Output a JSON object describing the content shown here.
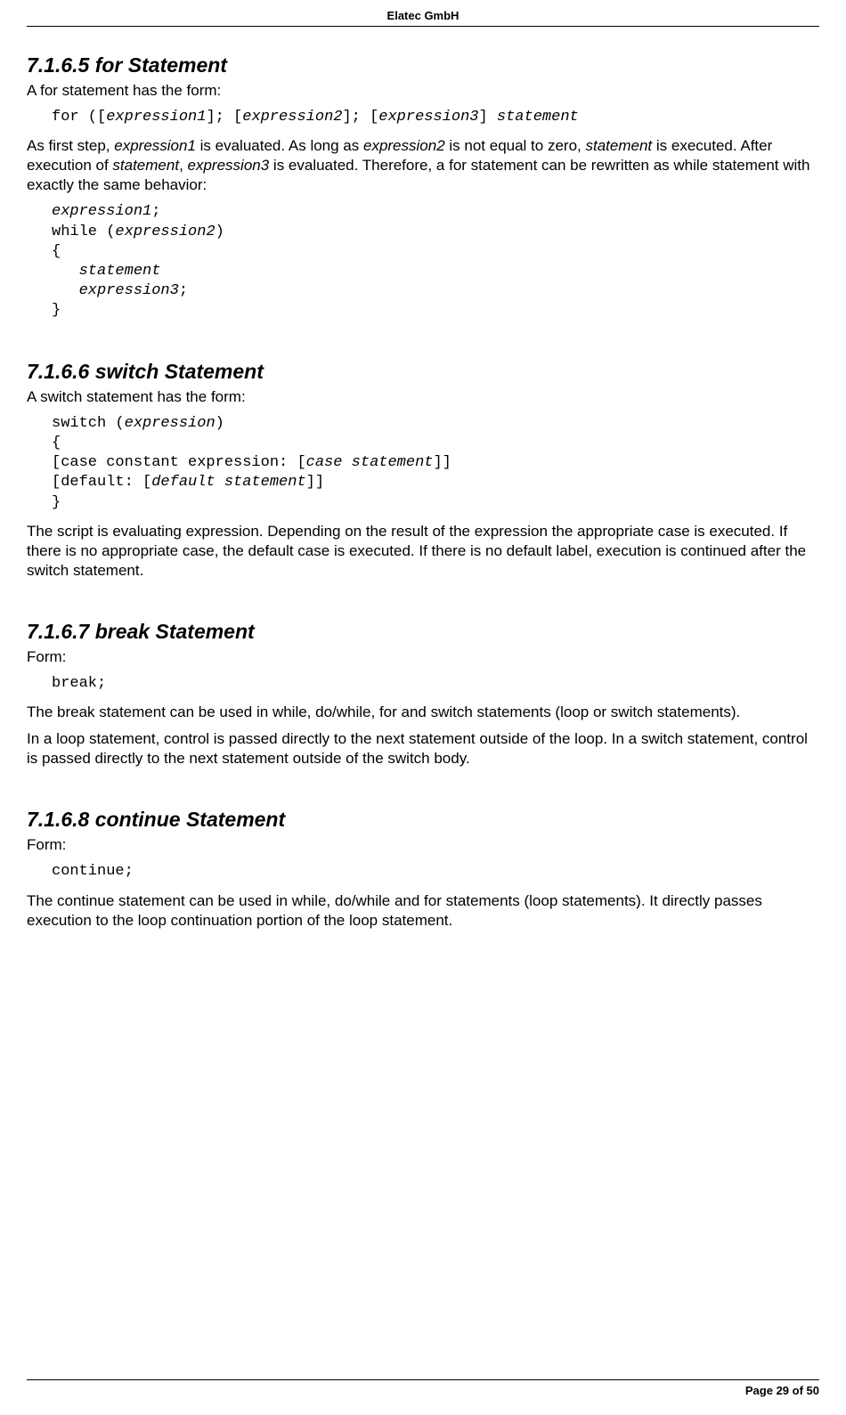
{
  "header": {
    "company": "Elatec GmbH"
  },
  "footer": {
    "text": "Page 29 of 50"
  },
  "s1": {
    "heading": "7.1.6.5  for Statement",
    "p1": "A for statement has the form:",
    "code1_plain1": "for ([",
    "code1_it1": "expression1",
    "code1_plain2": "]; [",
    "code1_it2": "expression2",
    "code1_plain3": "]; [",
    "code1_it3": "expression3",
    "code1_plain4": "] ",
    "code1_it4": "statement",
    "p2_a": "As first step, ",
    "p2_it1": "expression1",
    "p2_b": " is evaluated. As long as ",
    "p2_it2": "expression2",
    "p2_c": " is not equal to zero, ",
    "p2_it3": "statement",
    "p2_d": " is executed. After execution of ",
    "p2_it4": "statement",
    "p2_e": ", ",
    "p2_it5": "expression3",
    "p2_f": " is evaluated. Therefore, a for statement can be rewritten as while statement with exactly the same behavior:",
    "code2_l1_it": "expression1",
    "code2_l1_end": ";",
    "code2_l2_a": "while (",
    "code2_l2_it": "expression2",
    "code2_l2_b": ")",
    "code2_l3": "{",
    "code2_l4_pad": "   ",
    "code2_l4_it": "statement",
    "code2_l5_pad": "   ",
    "code2_l5_it": "expression3",
    "code2_l5_end": ";",
    "code2_l6": "}"
  },
  "s2": {
    "heading": "7.1.6.6  switch Statement",
    "p1": "A switch statement has the form:",
    "code_l1_a": "switch (",
    "code_l1_it": "expression",
    "code_l1_b": ")",
    "code_l2": "{",
    "code_l3_a": "[case constant expression: [",
    "code_l3_it": "case statement",
    "code_l3_b": "]]",
    "code_l4_a": "[default: [",
    "code_l4_it": "default statement",
    "code_l4_b": "]]",
    "code_l5": "}",
    "p2": "The script is evaluating expression. Depending on the result of the expression the appropriate case is executed. If there is no appropriate case, the default case is executed. If there is no default label, execution is continued after the switch statement."
  },
  "s3": {
    "heading": "7.1.6.7  break Statement",
    "p1": "Form:",
    "code": "break;",
    "p2": "The break statement can be used in while, do/while, for and switch statements (loop or switch statements).",
    "p3": "In a loop statement, control is passed directly to the next statement outside of the loop. In a switch statement, control is passed directly to the next statement outside of the switch body."
  },
  "s4": {
    "heading": "7.1.6.8  continue Statement",
    "p1": "Form:",
    "code": "continue;",
    "p2": "The continue statement can be used in while, do/while and for statements (loop statements). It directly passes execution to the loop continuation portion of the loop statement."
  }
}
